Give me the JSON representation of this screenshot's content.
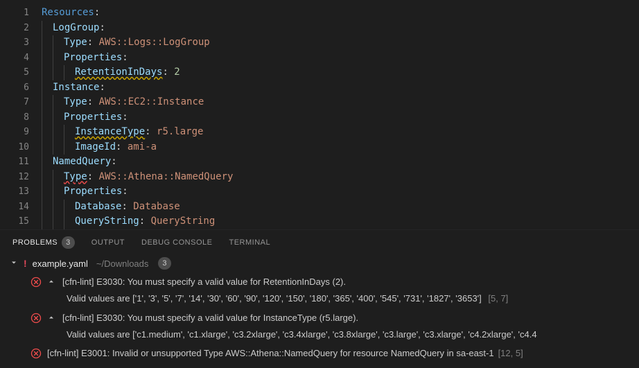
{
  "editor": {
    "lines": [
      {
        "n": "1",
        "seg": [
          {
            "t": "Resources",
            "c": "k-root"
          },
          {
            "t": ":",
            "c": "k-colon"
          }
        ],
        "indent": 0
      },
      {
        "n": "2",
        "seg": [
          {
            "t": "LogGroup",
            "c": "k-key"
          },
          {
            "t": ":",
            "c": "k-colon"
          }
        ],
        "indent": 1
      },
      {
        "n": "3",
        "seg": [
          {
            "t": "Type",
            "c": "k-key"
          },
          {
            "t": ": ",
            "c": "k-colon"
          },
          {
            "t": "AWS::Logs::LogGroup",
            "c": "k-type"
          }
        ],
        "indent": 2
      },
      {
        "n": "4",
        "seg": [
          {
            "t": "Properties",
            "c": "k-key"
          },
          {
            "t": ":",
            "c": "k-colon"
          }
        ],
        "indent": 2
      },
      {
        "n": "5",
        "seg": [
          {
            "t": "RetentionInDays",
            "c": "k-prop squiggle-yellow"
          },
          {
            "t": ": ",
            "c": "k-colon"
          },
          {
            "t": "2",
            "c": "k-num"
          }
        ],
        "indent": 3
      },
      {
        "n": "6",
        "seg": [
          {
            "t": "Instance",
            "c": "k-key"
          },
          {
            "t": ":",
            "c": "k-colon"
          }
        ],
        "indent": 1
      },
      {
        "n": "7",
        "seg": [
          {
            "t": "Type",
            "c": "k-key"
          },
          {
            "t": ": ",
            "c": "k-colon"
          },
          {
            "t": "AWS::EC2::Instance",
            "c": "k-type"
          }
        ],
        "indent": 2
      },
      {
        "n": "8",
        "seg": [
          {
            "t": "Properties",
            "c": "k-key"
          },
          {
            "t": ":",
            "c": "k-colon"
          }
        ],
        "indent": 2
      },
      {
        "n": "9",
        "seg": [
          {
            "t": "InstanceType",
            "c": "k-prop squiggle-yellow"
          },
          {
            "t": ": ",
            "c": "k-colon"
          },
          {
            "t": "r5.large",
            "c": "k-val"
          }
        ],
        "indent": 3
      },
      {
        "n": "10",
        "seg": [
          {
            "t": "ImageId",
            "c": "k-prop"
          },
          {
            "t": ": ",
            "c": "k-colon"
          },
          {
            "t": "ami-a",
            "c": "k-val"
          }
        ],
        "indent": 3
      },
      {
        "n": "11",
        "seg": [
          {
            "t": "NamedQuery",
            "c": "k-key"
          },
          {
            "t": ":",
            "c": "k-colon"
          }
        ],
        "indent": 1
      },
      {
        "n": "12",
        "seg": [
          {
            "t": "Type",
            "c": "k-key squiggle-red"
          },
          {
            "t": ": ",
            "c": "k-colon"
          },
          {
            "t": "AWS::Athena::NamedQuery",
            "c": "k-type"
          }
        ],
        "indent": 2
      },
      {
        "n": "13",
        "seg": [
          {
            "t": "Properties",
            "c": "k-key"
          },
          {
            "t": ":",
            "c": "k-colon"
          }
        ],
        "indent": 2
      },
      {
        "n": "14",
        "seg": [
          {
            "t": "Database",
            "c": "k-prop"
          },
          {
            "t": ": ",
            "c": "k-colon"
          },
          {
            "t": "Database",
            "c": "k-val"
          }
        ],
        "indent": 3
      },
      {
        "n": "15",
        "seg": [
          {
            "t": "QueryString",
            "c": "k-prop"
          },
          {
            "t": ": ",
            "c": "k-colon"
          },
          {
            "t": "QueryString",
            "c": "k-val"
          }
        ],
        "indent": 3
      }
    ]
  },
  "panel": {
    "tabs": {
      "problems": "PROBLEMS",
      "problems_badge": "3",
      "output": "OUTPUT",
      "debug": "DEBUG CONSOLE",
      "terminal": "TERMINAL"
    },
    "file": {
      "name": "example.yaml",
      "path": "~/Downloads",
      "badge": "3"
    },
    "problems": [
      {
        "msg": "[cfn-lint] E3030: You must specify a valid value for RetentionInDays (2).",
        "sub": "Valid values are ['1', '3', '5', '7', '14', '30', '60', '90', '120', '150', '180', '365', '400', '545', '731', '1827', '3653']",
        "loc": "[5, 7]",
        "expandable": true
      },
      {
        "msg": "[cfn-lint] E3030: You must specify a valid value for InstanceType (r5.large).",
        "sub": "Valid values are ['c1.medium', 'c1.xlarge', 'c3.2xlarge', 'c3.4xlarge', 'c3.8xlarge', 'c3.large', 'c3.xlarge', 'c4.2xlarge', 'c4.4",
        "loc": "",
        "expandable": true
      },
      {
        "msg": "[cfn-lint] E3001: Invalid or unsupported Type AWS::Athena::NamedQuery for resource NamedQuery in sa-east-1",
        "sub": "",
        "loc": "[12, 5]",
        "expandable": false
      }
    ]
  }
}
